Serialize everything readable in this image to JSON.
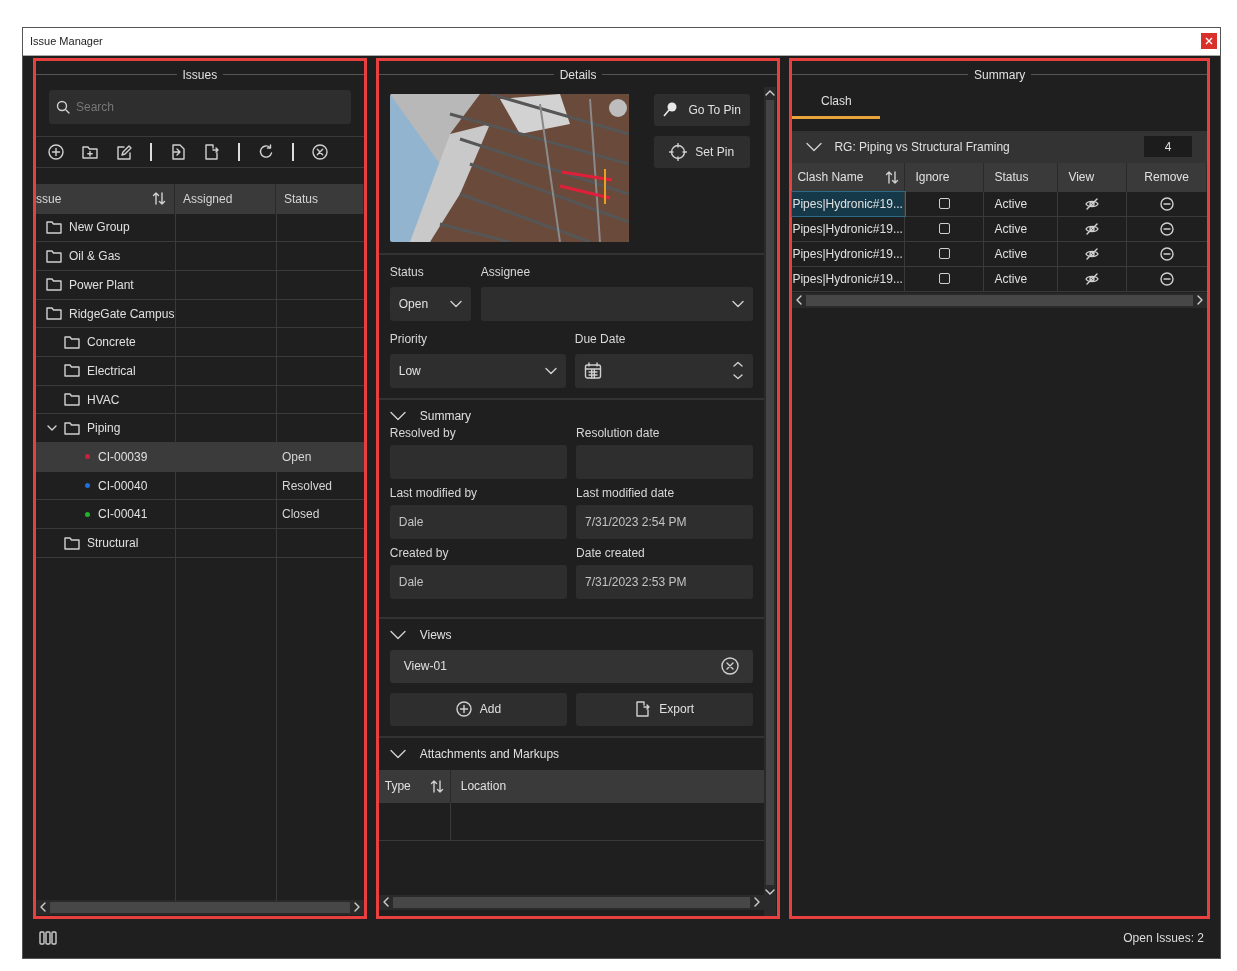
{
  "window": {
    "title": "Issue Manager"
  },
  "issues": {
    "title": "Issues",
    "search": {
      "placeholder": "Search"
    },
    "columns": [
      "ssue",
      "Assigned",
      "Status"
    ],
    "tree": [
      {
        "kind": "folder",
        "label": "New Group",
        "selected": false
      },
      {
        "kind": "folder",
        "label": "Oil & Gas",
        "selected": false
      },
      {
        "kind": "folder",
        "label": "Power Plant",
        "selected": false
      },
      {
        "kind": "folder",
        "label": "RidgeGate Campus",
        "selected": false,
        "children": [
          {
            "kind": "folder",
            "label": "Concrete",
            "selected": false
          },
          {
            "kind": "folder",
            "label": "Electrical",
            "selected": false
          },
          {
            "kind": "folder",
            "label": "HVAC",
            "selected": false
          },
          {
            "kind": "folder",
            "label": "Piping",
            "selected": false,
            "expanded": true,
            "children": [
              {
                "kind": "issue",
                "label": "CI-00039",
                "color": "#c8213c",
                "status": "Open",
                "selected": true
              },
              {
                "kind": "issue",
                "label": "CI-00040",
                "color": "#1e6fe0",
                "status": "Resolved",
                "selected": false
              },
              {
                "kind": "issue",
                "label": "CI-00041",
                "color": "#1fb52a",
                "status": "Closed",
                "selected": false
              }
            ]
          },
          {
            "kind": "folder",
            "label": "Structural",
            "selected": false
          }
        ]
      }
    ]
  },
  "details": {
    "title": "Details",
    "pin_buttons": [
      "Go To Pin",
      "Set Pin"
    ],
    "status": {
      "label": "Status",
      "value": "Open"
    },
    "assignee": {
      "label": "Assignee"
    },
    "priority": {
      "label": "Priority",
      "value": "Low"
    },
    "due_date": {
      "label": "Due Date"
    },
    "summary": {
      "title": "Summary",
      "expanded": true,
      "fields": [
        {
          "label": "Resolved by"
        },
        {
          "label": "Resolution date"
        },
        {
          "label": "Last modified by",
          "value": "Dale"
        },
        {
          "label": "Last modified date",
          "value": "7/31/2023 2:54 PM"
        },
        {
          "label": "Created by",
          "value": "Dale"
        },
        {
          "label": "Date created",
          "value": "7/31/2023 2:53 PM"
        }
      ]
    },
    "views": {
      "title": "Views",
      "expanded": true,
      "items": [
        "View-01"
      ],
      "buttons": [
        "Add",
        "Export"
      ]
    },
    "attachments": {
      "title": "Attachments and Markups",
      "expanded": true,
      "columns": [
        "Type",
        "Location"
      ]
    }
  },
  "summary": {
    "title": "Summary",
    "tabs": [
      {
        "label": "Clash",
        "selected": true
      }
    ],
    "group": {
      "label": "RG: Piping vs Structural Framing",
      "count": "4",
      "expanded": true
    },
    "columns": [
      "Clash Name",
      "Ignore",
      "Status",
      "View",
      "Remove"
    ],
    "rows": [
      {
        "name": "Pipes|Hydronic#19...",
        "ignore": false,
        "status": "Active",
        "selected": true
      },
      {
        "name": "Pipes|Hydronic#19...",
        "ignore": false,
        "status": "Active",
        "selected": false
      },
      {
        "name": "Pipes|Hydronic#19...",
        "ignore": false,
        "status": "Active",
        "selected": false
      },
      {
        "name": "Pipes|Hydronic#19...",
        "ignore": false,
        "status": "Active",
        "selected": false
      }
    ]
  },
  "status_bar": {
    "text": "Open Issues: 2"
  }
}
